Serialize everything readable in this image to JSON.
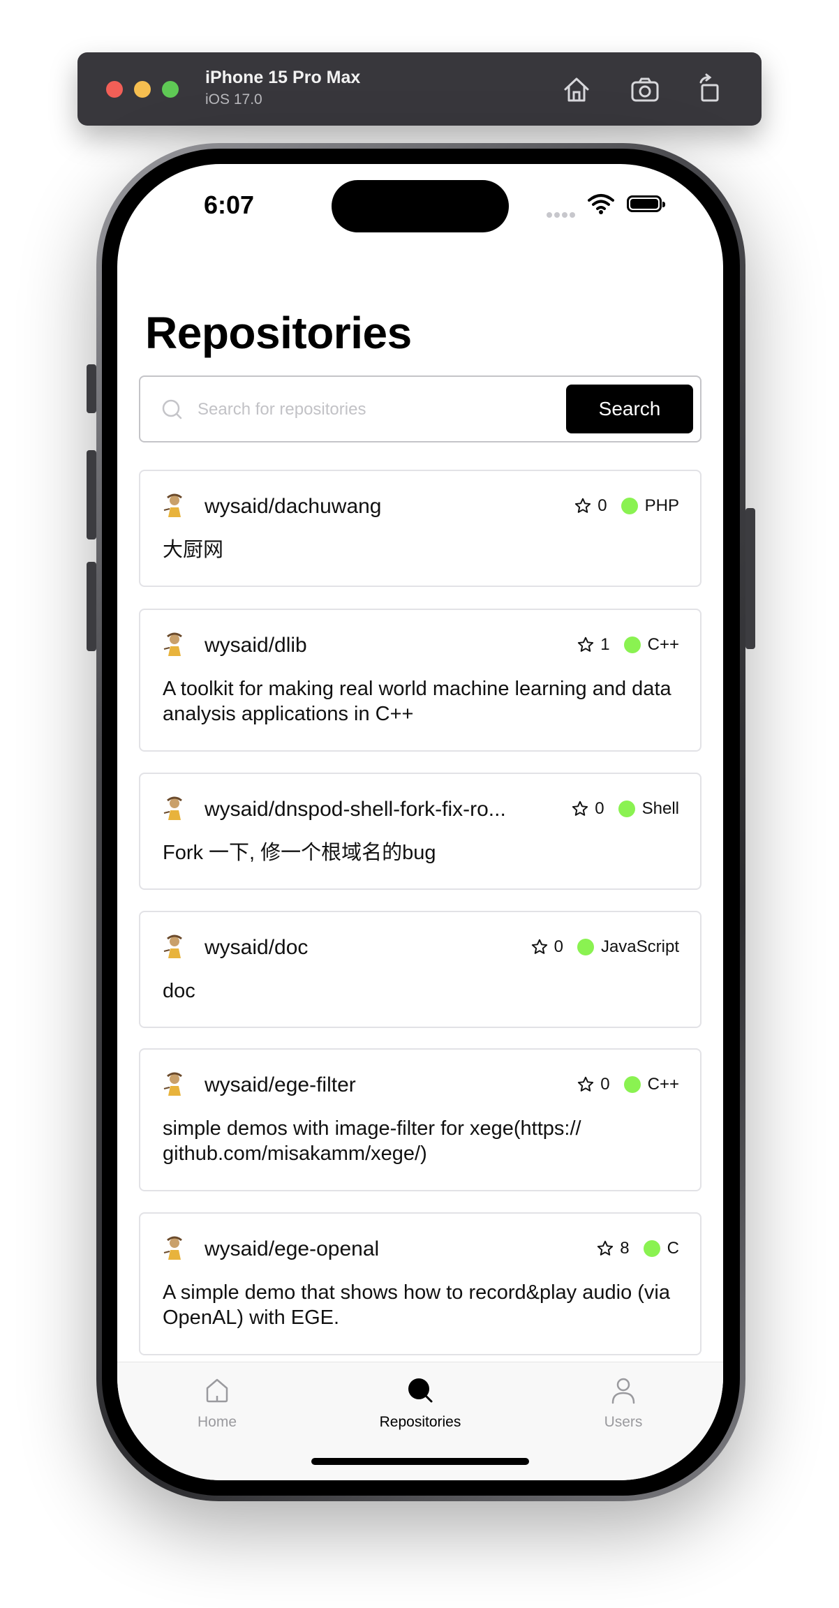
{
  "simulator": {
    "device": "iPhone 15 Pro Max",
    "os": "iOS 17.0"
  },
  "status_bar": {
    "time": "6:07"
  },
  "page": {
    "title": "Repositories"
  },
  "search": {
    "placeholder": "Search for repositories",
    "value": "",
    "button_label": "Search"
  },
  "repos": [
    {
      "name": "wysaid/dachuwang",
      "stars": "0",
      "language": "PHP",
      "description": "大厨网"
    },
    {
      "name": "wysaid/dlib",
      "stars": "1",
      "language": "C++",
      "description": "A toolkit for making real world machine learning and data analysis applications in C++"
    },
    {
      "name": "wysaid/dnspod-shell-fork-fix-ro...",
      "stars": "0",
      "language": "Shell",
      "description": "Fork 一下, 修一个根域名的bug"
    },
    {
      "name": "wysaid/doc",
      "stars": "0",
      "language": "JavaScript",
      "description": "doc"
    },
    {
      "name": "wysaid/ege-filter",
      "stars": "0",
      "language": "C++",
      "description": "simple demos with image-filter for xege(https:// github.com/misakamm/xege/)"
    },
    {
      "name": "wysaid/ege-openal",
      "stars": "8",
      "language": "C",
      "description": "A simple demo that shows how to record&play audio (via OpenAL) with EGE."
    }
  ],
  "language_dot_color": "#8af251",
  "tabs": [
    {
      "label": "Home",
      "icon": "home-icon",
      "active": false
    },
    {
      "label": "Repositories",
      "icon": "search-icon",
      "active": true
    },
    {
      "label": "Users",
      "icon": "person-icon",
      "active": false
    }
  ]
}
